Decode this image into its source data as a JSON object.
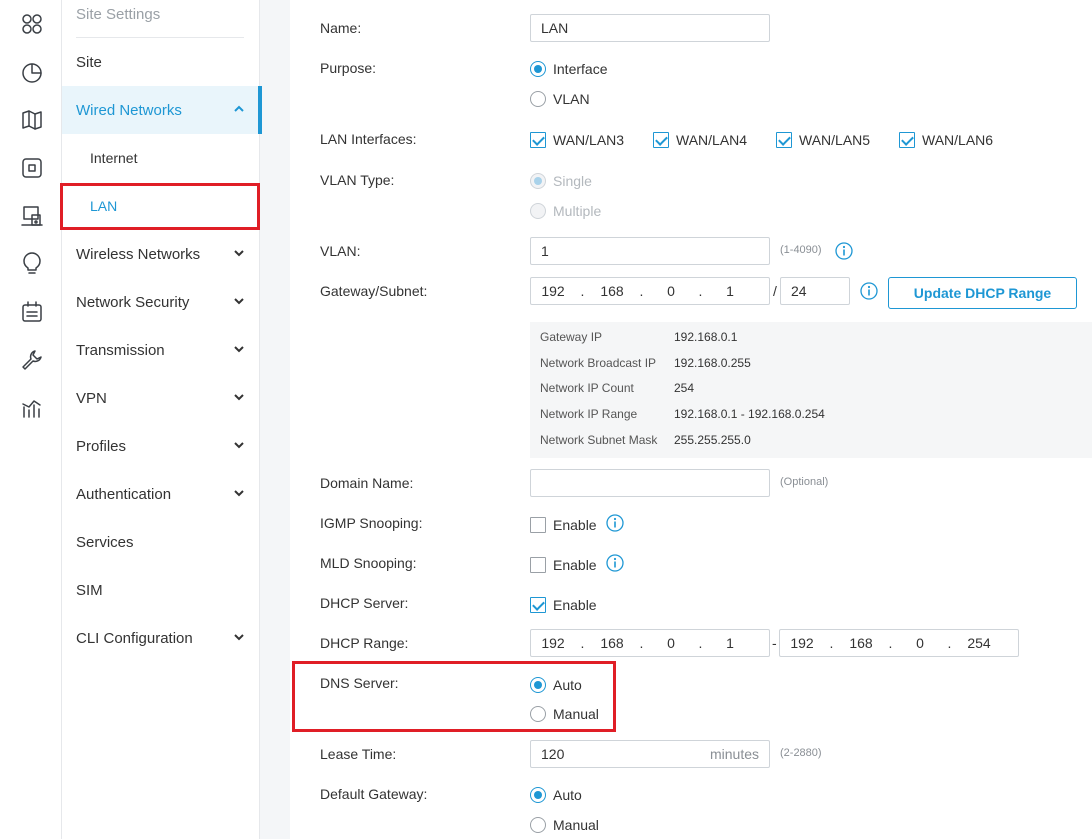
{
  "rail": {
    "icons": [
      "dashboard-icon",
      "statistics-icon",
      "map-icon",
      "devices-icon",
      "clients-icon",
      "insight-icon",
      "logs-icon",
      "tools-icon",
      "reports-icon"
    ]
  },
  "sidebar": {
    "header": "Site Settings",
    "items": [
      {
        "label": "Site"
      },
      {
        "label": "Wired Networks"
      },
      {
        "label": "Internet"
      },
      {
        "label": "LAN"
      },
      {
        "label": "Wireless Networks"
      },
      {
        "label": "Network Security"
      },
      {
        "label": "Transmission"
      },
      {
        "label": "VPN"
      },
      {
        "label": "Profiles"
      },
      {
        "label": "Authentication"
      },
      {
        "label": "Services"
      },
      {
        "label": "SIM"
      },
      {
        "label": "CLI Configuration"
      }
    ]
  },
  "form": {
    "name": {
      "label": "Name:",
      "value": "LAN"
    },
    "purpose": {
      "label": "Purpose:",
      "options": [
        "Interface",
        "VLAN"
      ],
      "selected": "Interface"
    },
    "lan_interfaces": {
      "label": "LAN Interfaces:",
      "options": [
        "WAN/LAN3",
        "WAN/LAN4",
        "WAN/LAN5",
        "WAN/LAN6"
      ]
    },
    "vlan_type": {
      "label": "VLAN Type:",
      "options": [
        "Single",
        "Multiple"
      ],
      "selected": "Single"
    },
    "vlan": {
      "label": "VLAN:",
      "value": "1",
      "hint": "(1-4090)"
    },
    "gateway": {
      "label": "Gateway/Subnet:",
      "octets": [
        "192",
        "168",
        "0",
        "1"
      ],
      "mask": "24",
      "update_button": "Update DHCP Range"
    },
    "network_info": {
      "gateway_ip": {
        "label": "Gateway IP",
        "value": "192.168.0.1"
      },
      "broadcast_ip": {
        "label": "Network Broadcast IP",
        "value": "192.168.0.255"
      },
      "ip_count": {
        "label": "Network IP Count",
        "value": "254"
      },
      "ip_range": {
        "label": "Network IP Range",
        "value": "192.168.0.1 - 192.168.0.254"
      },
      "subnet_mask": {
        "label": "Network Subnet Mask",
        "value": "255.255.255.0"
      }
    },
    "domain_name": {
      "label": "Domain Name:",
      "value": "",
      "hint": "(Optional)"
    },
    "igmp": {
      "label": "IGMP Snooping:",
      "option": "Enable",
      "checked": false
    },
    "mld": {
      "label": "MLD Snooping:",
      "option": "Enable",
      "checked": false
    },
    "dhcp_server": {
      "label": "DHCP Server:",
      "option": "Enable",
      "checked": true
    },
    "dhcp_range": {
      "label": "DHCP Range:",
      "start": [
        "192",
        "168",
        "0",
        "1"
      ],
      "end": [
        "192",
        "168",
        "0",
        "254"
      ],
      "dash": "-"
    },
    "dns_server": {
      "label": "DNS Server:",
      "options": [
        "Auto",
        "Manual"
      ],
      "selected": "Auto"
    },
    "lease_time": {
      "label": "Lease Time:",
      "value": "120",
      "unit": "minutes",
      "hint": "(2-2880)"
    },
    "default_gateway": {
      "label": "Default Gateway:",
      "options": [
        "Auto",
        "Manual"
      ],
      "selected": "Auto"
    }
  },
  "colors": {
    "accent": "#1e97d4",
    "highlight": "#e01e26"
  }
}
